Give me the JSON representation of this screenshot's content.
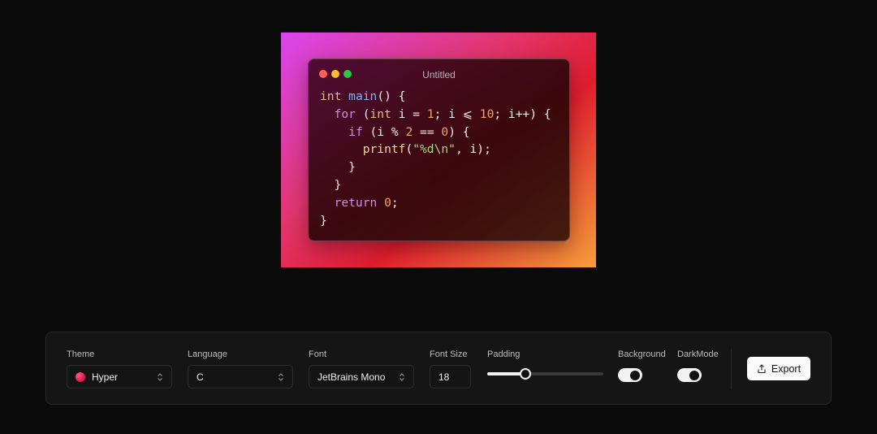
{
  "preview": {
    "window_title": "Untitled",
    "window_controls": [
      "close",
      "minimize",
      "maximize"
    ],
    "code_lines": [
      [
        {
          "t": "int",
          "c": "ty"
        },
        {
          "t": " ",
          "c": "pl"
        },
        {
          "t": "main",
          "c": "fn"
        },
        {
          "t": "() {",
          "c": "pl"
        }
      ],
      [
        {
          "t": "  ",
          "c": "pl"
        },
        {
          "t": "for",
          "c": "kw"
        },
        {
          "t": " (",
          "c": "pl"
        },
        {
          "t": "int",
          "c": "ty"
        },
        {
          "t": " i = ",
          "c": "pl"
        },
        {
          "t": "1",
          "c": "num"
        },
        {
          "t": "; i ⩽ ",
          "c": "pl"
        },
        {
          "t": "10",
          "c": "num"
        },
        {
          "t": "; i++) {",
          "c": "pl"
        }
      ],
      [
        {
          "t": "    ",
          "c": "pl"
        },
        {
          "t": "if",
          "c": "kw"
        },
        {
          "t": " (i % ",
          "c": "pl"
        },
        {
          "t": "2",
          "c": "num"
        },
        {
          "t": " == ",
          "c": "pl"
        },
        {
          "t": "0",
          "c": "num"
        },
        {
          "t": ") {",
          "c": "pl"
        }
      ],
      [
        {
          "t": "      ",
          "c": "pl"
        },
        {
          "t": "printf",
          "c": "fn2"
        },
        {
          "t": "(",
          "c": "pl"
        },
        {
          "t": "\"%d\\n\"",
          "c": "str"
        },
        {
          "t": ", i);",
          "c": "pl"
        }
      ],
      [
        {
          "t": "    }",
          "c": "pl"
        }
      ],
      [
        {
          "t": "  }",
          "c": "pl"
        }
      ],
      [
        {
          "t": "  ",
          "c": "pl"
        },
        {
          "t": "return",
          "c": "kw"
        },
        {
          "t": " ",
          "c": "pl"
        },
        {
          "t": "0",
          "c": "num"
        },
        {
          "t": ";",
          "c": "pl"
        }
      ],
      [
        {
          "t": "}",
          "c": "pl"
        }
      ]
    ],
    "colors": {
      "gradient": [
        "#d946ef",
        "#e23670",
        "#e11d2e",
        "#f59e3a"
      ]
    }
  },
  "toolbar": {
    "theme": {
      "label": "Theme",
      "value": "Hyper"
    },
    "language": {
      "label": "Language",
      "value": "C"
    },
    "font": {
      "label": "Font",
      "value": "JetBrains Mono"
    },
    "font_size": {
      "label": "Font Size",
      "value": "18"
    },
    "padding": {
      "label": "Padding",
      "level_fraction": 0.33
    },
    "background": {
      "label": "Background",
      "enabled": true
    },
    "dark_mode": {
      "label": "DarkMode",
      "enabled": true
    },
    "export": {
      "label": "Export",
      "icon": "share-icon"
    }
  }
}
